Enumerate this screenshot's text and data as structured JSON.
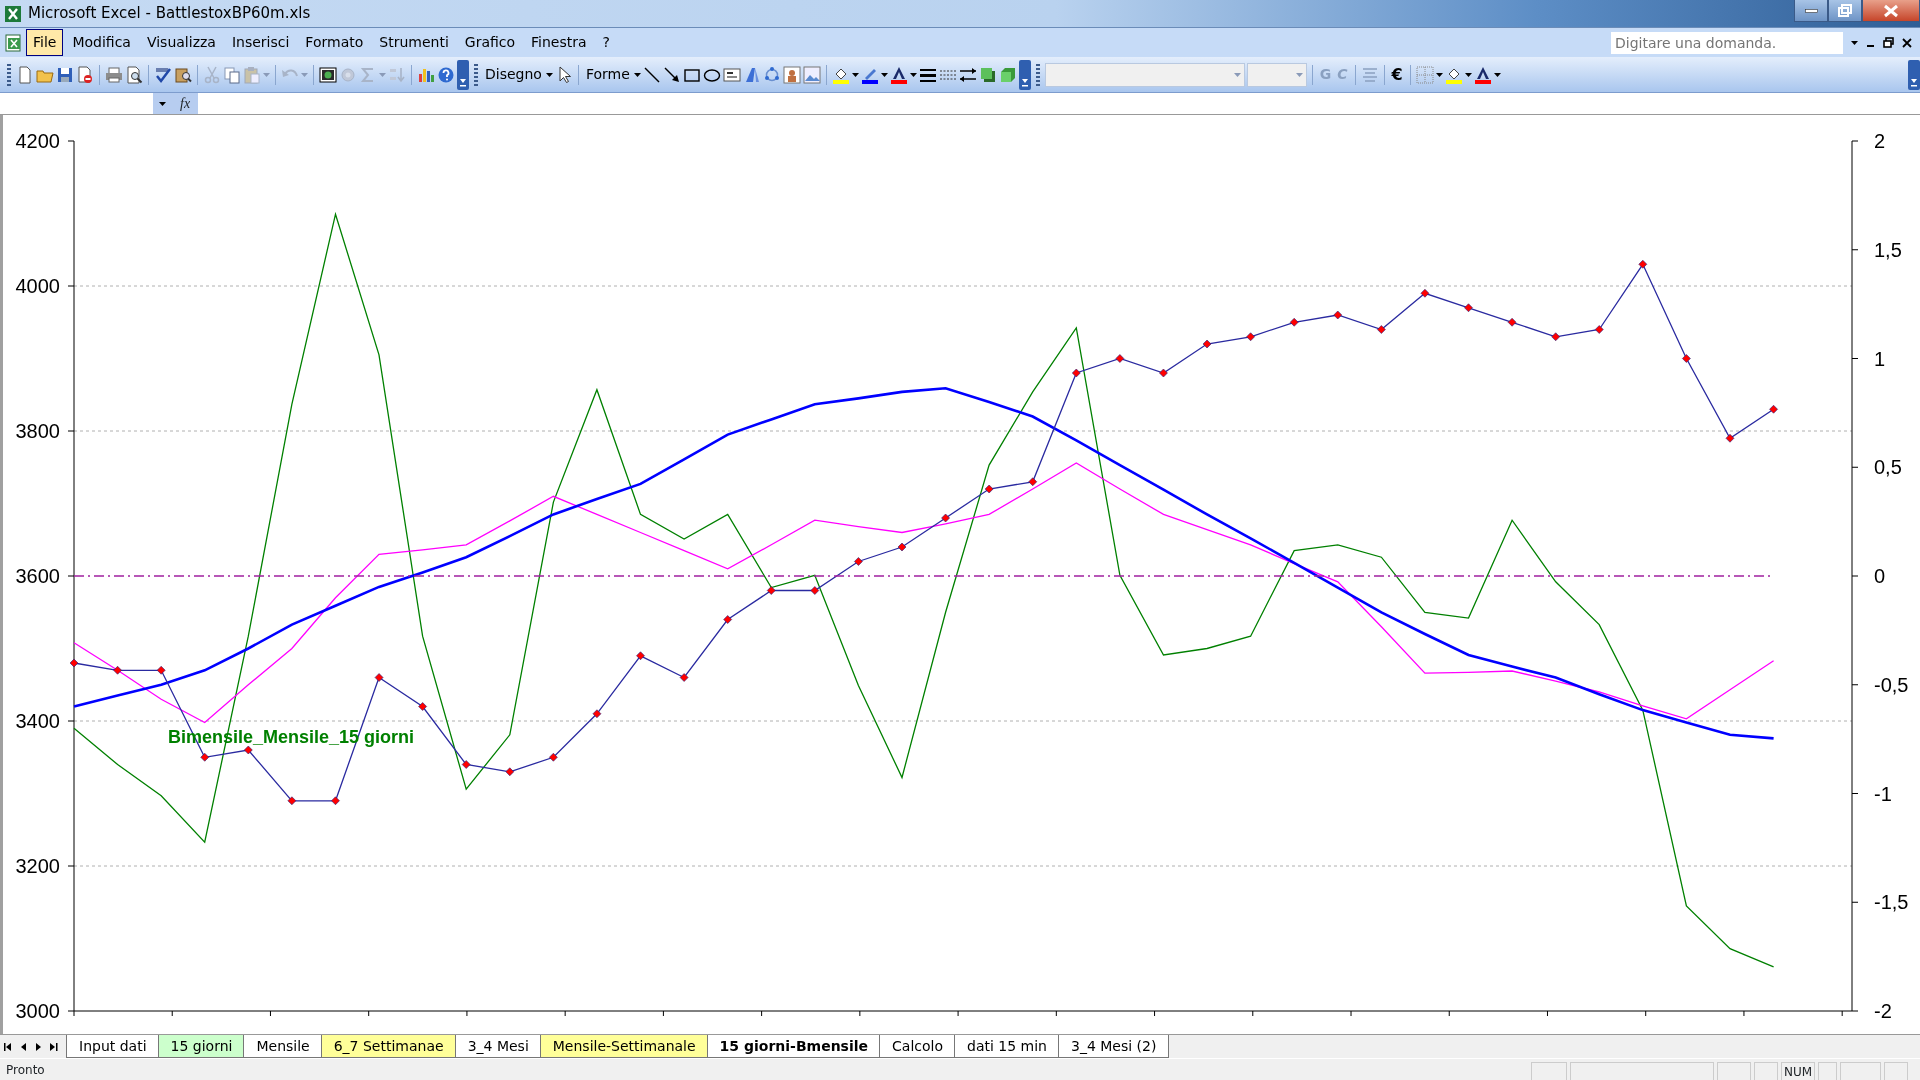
{
  "window": {
    "title": "Microsoft Excel - BattlestoxBP60m.xls"
  },
  "menu": [
    {
      "label": "File",
      "selected": true
    },
    {
      "label": "Modifica",
      "selected": false
    },
    {
      "label": "Visualizza",
      "selected": false
    },
    {
      "label": "Inserisci",
      "selected": false
    },
    {
      "label": "Formato",
      "selected": false
    },
    {
      "label": "Strumenti",
      "selected": false
    },
    {
      "label": "Grafico",
      "selected": false
    },
    {
      "label": "Finestra",
      "selected": false
    },
    {
      "label": "?",
      "selected": false
    }
  ],
  "help_search": {
    "placeholder": "Digitare una domanda."
  },
  "toolbar": {
    "drawing_menu": "Disegno",
    "shapes_menu": "Forme",
    "bold": {
      "label": "G",
      "disabled": true
    },
    "italic": {
      "label": "C",
      "disabled": true
    },
    "currency": "€"
  },
  "formula_bar": {
    "function_label": "fx"
  },
  "chart": {
    "right_axis_labels": [
      "2",
      "1,5",
      "1",
      "0,5",
      "0",
      "-0,5",
      "-1",
      "-1,5",
      "-2"
    ],
    "chart_data": {
      "type": "line",
      "categories": [
        null,
        null,
        null,
        null,
        null,
        null,
        null,
        null,
        null,
        null,
        null,
        null,
        null,
        null,
        null,
        null,
        null,
        null,
        null,
        null,
        null,
        null,
        null,
        null,
        null,
        null,
        null,
        null,
        null,
        null,
        null,
        null,
        null,
        null,
        null,
        null,
        null,
        null,
        null,
        null
      ],
      "ylim": [
        3000,
        4200
      ],
      "yticks": [
        3000,
        3200,
        3400,
        3600,
        3800,
        4000,
        4200
      ],
      "grid": true,
      "series": [
        {
          "color": "#008000",
          "values": [
            3390,
            3340,
            3297,
            3233,
            3517,
            3837,
            4099,
            3905,
            3517,
            3306,
            3381,
            3702,
            3857,
            3685,
            3651,
            3685,
            3584,
            3601,
            3449,
            3322,
            3550,
            3753,
            3854,
            3942,
            3601,
            3491,
            3500,
            3517,
            3635,
            3643,
            3626,
            3550,
            3542,
            3677,
            3592,
            3533,
            3415,
            3145,
            3086,
            3061
          ]
        },
        {
          "color": "#ff00ff",
          "values": [
            3508,
            3470,
            3430,
            3398,
            3450,
            3500,
            3570,
            3630,
            3636,
            3643,
            3676,
            3710,
            3685,
            3660,
            3635,
            3610,
            3643,
            3677,
            3668,
            3660,
            3672,
            3685,
            3720,
            3756,
            3720,
            3685,
            3664,
            3643,
            3617,
            3592,
            3530,
            3466,
            3467,
            3469,
            3455,
            3440,
            3421,
            3403,
            3443,
            3483
          ]
        },
        {
          "color": "#0000ff",
          "values": [
            3420,
            3435,
            3450,
            3470,
            3500,
            3533,
            3559,
            3585,
            3605,
            3626,
            3655,
            3685,
            3706,
            3727,
            3761,
            3795,
            3816,
            3837,
            3845,
            3854,
            3859,
            3840,
            3820,
            3787,
            3753,
            3719,
            3685,
            3652,
            3618,
            3584,
            3550,
            3520,
            3491,
            3475,
            3460,
            3437,
            3415,
            3398,
            3381,
            3376
          ]
        },
        {
          "color": "#2a2aa0",
          "marker": "diamond",
          "values": [
            3480,
            3470,
            3470,
            3350,
            3360,
            3290,
            3290,
            3460,
            3420,
            3340,
            3330,
            3350,
            3410,
            3490,
            3460,
            3540,
            3580,
            3580,
            3620,
            3640,
            3680,
            3720,
            3730,
            3880,
            3900,
            3880,
            3920,
            3930,
            3950,
            3960,
            3940,
            3990,
            3970,
            3950,
            3930,
            3940,
            4030,
            3900,
            3790,
            3830
          ]
        },
        {
          "color": "#a020a0",
          "line_style": "dashdot",
          "values": [
            3600,
            3600,
            3600,
            3600,
            3600,
            3600,
            3600,
            3600,
            3600,
            3600,
            3600,
            3600,
            3600,
            3600,
            3600,
            3600,
            3600,
            3600,
            3600,
            3600,
            3600,
            3600,
            3600,
            3600,
            3600,
            3600,
            3600,
            3600,
            3600,
            3600,
            3600,
            3600,
            3600,
            3600,
            3600,
            3600,
            3600,
            3600,
            3600,
            3600
          ]
        }
      ],
      "annotations": [
        {
          "text": "Bimensile_Mensile_15 giorni"
        }
      ]
    }
  },
  "sheet_tabs": [
    {
      "label": "Input dati",
      "selected": false,
      "color": "#ffffff"
    },
    {
      "label": "15 giorni",
      "selected": false,
      "color": "#ccffcc"
    },
    {
      "label": "Mensile",
      "selected": false,
      "color": "#ffffff"
    },
    {
      "label": "6_7 Settimanae",
      "selected": false,
      "color": "#ffff99"
    },
    {
      "label": "3_4 Mesi",
      "selected": false,
      "color": "#ffffff"
    },
    {
      "label": "Mensile-Settimanale",
      "selected": false,
      "color": "#ffff99"
    },
    {
      "label": "15 giorni-Bmensile",
      "selected": true,
      "color": "#ffffff"
    },
    {
      "label": "Calcolo",
      "selected": false,
      "color": "#ffffff"
    },
    {
      "label": "dati 15 min",
      "selected": false,
      "color": "#ffffff"
    },
    {
      "label": "3_4 Mesi (2)",
      "selected": false,
      "color": "#ffffff"
    }
  ],
  "status_bar": {
    "text": "Pronto",
    "indicators": [
      "NUM"
    ]
  }
}
